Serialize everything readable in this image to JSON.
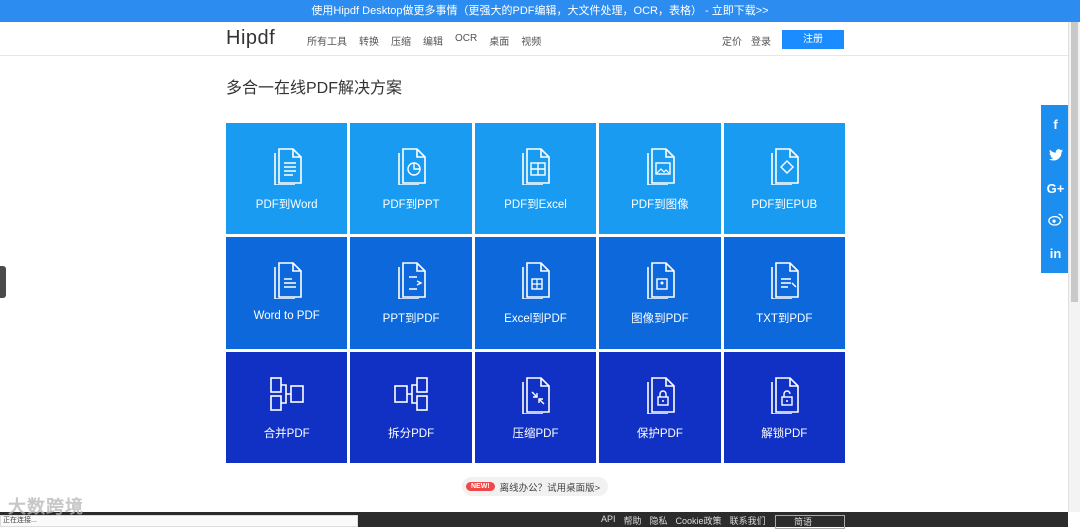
{
  "banner": {
    "text": "使用Hipdf Desktop做更多事情（更强大的PDF编辑，大文件处理，OCR，表格）",
    "link": " - 立即下载>>"
  },
  "nav": {
    "logo": "Hipdf",
    "menu": [
      "所有工具",
      "转换",
      "压缩",
      "编辑",
      "OCR",
      "桌面",
      "视频"
    ],
    "pricing": "定价",
    "login": "登录",
    "signup": "注册"
  },
  "page": {
    "title": "多合一在线PDF解决方案"
  },
  "tools": [
    {
      "label": "PDF到Word",
      "icon": "pdf-to-word-icon",
      "row": 1
    },
    {
      "label": "PDF到PPT",
      "icon": "pdf-to-ppt-icon",
      "row": 1
    },
    {
      "label": "PDF到Excel",
      "icon": "pdf-to-excel-icon",
      "row": 1
    },
    {
      "label": "PDF到图像",
      "icon": "pdf-to-image-icon",
      "row": 1
    },
    {
      "label": "PDF到EPUB",
      "icon": "pdf-to-epub-icon",
      "row": 1
    },
    {
      "label": "Word to PDF",
      "icon": "word-to-pdf-icon",
      "row": 2
    },
    {
      "label": "PPT到PDF",
      "icon": "ppt-to-pdf-icon",
      "row": 2
    },
    {
      "label": "Excel到PDF",
      "icon": "excel-to-pdf-icon",
      "row": 2
    },
    {
      "label": "图像到PDF",
      "icon": "image-to-pdf-icon",
      "row": 2
    },
    {
      "label": "TXT到PDF",
      "icon": "txt-to-pdf-icon",
      "row": 2
    },
    {
      "label": "合并PDF",
      "icon": "merge-pdf-icon",
      "row": 3
    },
    {
      "label": "拆分PDF",
      "icon": "split-pdf-icon",
      "row": 3
    },
    {
      "label": "压缩PDF",
      "icon": "compress-pdf-icon",
      "row": 3
    },
    {
      "label": "保护PDF",
      "icon": "protect-pdf-icon",
      "row": 3
    },
    {
      "label": "解锁PDF",
      "icon": "unlock-pdf-icon",
      "row": 3
    }
  ],
  "promo": {
    "badge": "NEW!",
    "text": "离线办公？试用桌面版>"
  },
  "social": [
    "f",
    "t",
    "G+",
    "wb",
    "in"
  ],
  "footer": {
    "links": [
      "API",
      "帮助",
      "隐私",
      "Cookie政策",
      "联系我们"
    ],
    "language": "简语"
  },
  "statusbar": {
    "text": "正在连接..."
  },
  "watermark": {
    "text": "大数跨境"
  },
  "colors": {
    "row1": "#1a9bf2",
    "row2": "#0c68db",
    "row3": "#1131c4",
    "accent": "#1a8cff"
  }
}
